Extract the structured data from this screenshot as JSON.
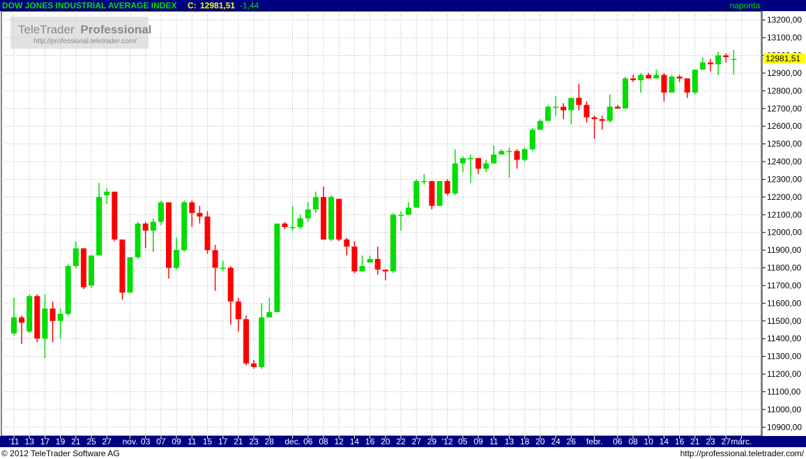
{
  "header": {
    "instrument": "DOW JONES INDUSTRIAL AVERAGE INDEX",
    "close_prefix": "C:",
    "close_value": "12981,51",
    "change": "-1,44",
    "period": "naponta"
  },
  "watermark": {
    "brand": "TeleTrader",
    "brand_bold": "Professional",
    "url": "http://professional.teletrader.com/"
  },
  "footer": {
    "copyright": "© 2012  TeleTrader Software AG",
    "url": "http://professional.teletrader.com/"
  },
  "colors": {
    "header_bg": "#000080",
    "header_text": "#00e000",
    "up": "#00dd00",
    "down": "#ff0000",
    "last_price_bg": "#ffff00",
    "grid": "#b0b0b0"
  },
  "chart_data": {
    "type": "candlestick",
    "y_axis": {
      "min": 10850,
      "max": 13250,
      "side": "right",
      "tick_values": [
        13200,
        13100,
        13000,
        12900,
        12800,
        12700,
        12600,
        12500,
        12400,
        12300,
        12200,
        12100,
        12000,
        11900,
        11800,
        11700,
        11600,
        11500,
        11400,
        11300,
        11200,
        11100,
        11000,
        10900
      ],
      "tick_labels": [
        "13200,00",
        "13100,00",
        "13000,00",
        "12900,00",
        "12800,00",
        "12700,00",
        "12600,00",
        "12500,00",
        "12400,00",
        "12300,00",
        "12200,00",
        "12100,00",
        "12000,00",
        "11900,00",
        "11800,00",
        "11700,00",
        "11600,00",
        "11500,00",
        "11400,00",
        "11300,00",
        "11200,00",
        "11100,00",
        "11000,00",
        "10900,00"
      ]
    },
    "x_labels": [
      {
        "i": 0,
        "t": "'11"
      },
      {
        "i": 2,
        "t": "13"
      },
      {
        "i": 4,
        "t": "17"
      },
      {
        "i": 6,
        "t": "19"
      },
      {
        "i": 8,
        "t": "21"
      },
      {
        "i": 10,
        "t": "25"
      },
      {
        "i": 12,
        "t": "27"
      },
      {
        "i": 15,
        "t": "nov."
      },
      {
        "i": 17,
        "t": "03"
      },
      {
        "i": 19,
        "t": "07"
      },
      {
        "i": 21,
        "t": "09"
      },
      {
        "i": 23,
        "t": "11"
      },
      {
        "i": 25,
        "t": "15"
      },
      {
        "i": 27,
        "t": "17"
      },
      {
        "i": 29,
        "t": "21"
      },
      {
        "i": 31,
        "t": "23"
      },
      {
        "i": 33,
        "t": "28"
      },
      {
        "i": 36,
        "t": "dec."
      },
      {
        "i": 38,
        "t": "06"
      },
      {
        "i": 40,
        "t": "08"
      },
      {
        "i": 42,
        "t": "12"
      },
      {
        "i": 44,
        "t": "14"
      },
      {
        "i": 46,
        "t": "16"
      },
      {
        "i": 48,
        "t": "20"
      },
      {
        "i": 50,
        "t": "22"
      },
      {
        "i": 52,
        "t": "27"
      },
      {
        "i": 54,
        "t": "29"
      },
      {
        "i": 56,
        "t": "'12"
      },
      {
        "i": 58,
        "t": "05"
      },
      {
        "i": 60,
        "t": "09"
      },
      {
        "i": 62,
        "t": "11"
      },
      {
        "i": 64,
        "t": "13"
      },
      {
        "i": 66,
        "t": "18"
      },
      {
        "i": 68,
        "t": "20"
      },
      {
        "i": 70,
        "t": "24"
      },
      {
        "i": 72,
        "t": "26"
      },
      {
        "i": 75,
        "t": "febr."
      },
      {
        "i": 78,
        "t": "06"
      },
      {
        "i": 80,
        "t": "08"
      },
      {
        "i": 82,
        "t": "10"
      },
      {
        "i": 84,
        "t": "14"
      },
      {
        "i": 86,
        "t": "16"
      },
      {
        "i": 88,
        "t": "21"
      },
      {
        "i": 90,
        "t": "23"
      },
      {
        "i": 92,
        "t": "27"
      },
      {
        "i": 94,
        "t": "márc."
      }
    ],
    "last_price": 12981.51,
    "last_price_label": "12981,51",
    "candles": [
      [
        11430,
        11520,
        11630,
        11420
      ],
      [
        11520,
        11490,
        11530,
        11370
      ],
      [
        11440,
        11640,
        11650,
        11430
      ],
      [
        11640,
        11400,
        11650,
        11380
      ],
      [
        11400,
        11570,
        11650,
        11290
      ],
      [
        11570,
        11500,
        11610,
        11380
      ],
      [
        11500,
        11540,
        11570,
        11400
      ],
      [
        11540,
        11810,
        11820,
        11530
      ],
      [
        11810,
        11910,
        11950,
        11800
      ],
      [
        11910,
        11690,
        11910,
        11680
      ],
      [
        11700,
        11870,
        11870,
        11690
      ],
      [
        11870,
        12200,
        12280,
        11870
      ],
      [
        12210,
        12230,
        12250,
        12160
      ],
      [
        12230,
        11960,
        12230,
        11950
      ],
      [
        11960,
        11660,
        11960,
        11620
      ],
      [
        11660,
        11860,
        11860,
        11660
      ],
      [
        11860,
        12050,
        12060,
        11850
      ],
      [
        12050,
        12010,
        12060,
        11910
      ],
      [
        12010,
        12060,
        12080,
        11890
      ],
      [
        12060,
        12170,
        12180,
        12040
      ],
      [
        12170,
        11800,
        12170,
        11740
      ],
      [
        11800,
        11900,
        11970,
        11790
      ],
      [
        11900,
        12170,
        12180,
        11890
      ],
      [
        12170,
        12110,
        12180,
        12030
      ],
      [
        12110,
        12090,
        12150,
        12050
      ],
      [
        12090,
        11900,
        12120,
        11880
      ],
      [
        11900,
        11800,
        11930,
        11670
      ],
      [
        11800,
        11800,
        11840,
        11780
      ],
      [
        11800,
        11610,
        11810,
        11480
      ],
      [
        11610,
        11510,
        11630,
        11440
      ],
      [
        11510,
        11260,
        11530,
        11250
      ],
      [
        11260,
        11240,
        11280,
        11230
      ],
      [
        11240,
        11520,
        11600,
        11230
      ],
      [
        11520,
        11550,
        11630,
        11520
      ],
      [
        11550,
        12050,
        12050,
        11550
      ],
      [
        12050,
        12030,
        12060,
        12020
      ],
      [
        12030,
        12030,
        12150,
        12010
      ],
      [
        12030,
        12080,
        12100,
        12020
      ],
      [
        12080,
        12130,
        12170,
        12060
      ],
      [
        12130,
        12200,
        12230,
        12110
      ],
      [
        12200,
        11960,
        12260,
        11960
      ],
      [
        11960,
        12200,
        12210,
        11950
      ],
      [
        12190,
        11960,
        12190,
        11950
      ],
      [
        11960,
        11920,
        11970,
        11870
      ],
      [
        11920,
        11780,
        11950,
        11770
      ],
      [
        11780,
        11810,
        11870,
        11780
      ],
      [
        11830,
        11850,
        11870,
        11830
      ],
      [
        11850,
        11790,
        11920,
        11760
      ],
      [
        11790,
        11780,
        11790,
        11730
      ],
      [
        11780,
        12100,
        12110,
        11770
      ],
      [
        12100,
        12100,
        12120,
        12010
      ],
      [
        12100,
        12140,
        12170,
        12100
      ],
      [
        12140,
        12290,
        12300,
        12140
      ],
      [
        12290,
        12290,
        12330,
        12270
      ],
      [
        12290,
        12150,
        12290,
        12130
      ],
      [
        12150,
        12290,
        12290,
        12150
      ],
      [
        12290,
        12220,
        12300,
        12210
      ],
      [
        12220,
        12390,
        12470,
        12210
      ],
      [
        12390,
        12420,
        12430,
        12340
      ],
      [
        12420,
        12420,
        12440,
        12280
      ],
      [
        12420,
        12360,
        12370,
        12330
      ],
      [
        12360,
        12390,
        12410,
        12340
      ],
      [
        12390,
        12440,
        12490,
        12390
      ],
      [
        12440,
        12460,
        12470,
        12440
      ],
      [
        12460,
        12460,
        12480,
        12310
      ],
      [
        12460,
        12410,
        12470,
        12360
      ],
      [
        12410,
        12470,
        12480,
        12400
      ],
      [
        12470,
        12580,
        12590,
        12460
      ],
      [
        12580,
        12630,
        12640,
        12580
      ],
      [
        12630,
        12710,
        12720,
        12630
      ],
      [
        12710,
        12710,
        12770,
        12660
      ],
      [
        12710,
        12690,
        12730,
        12640
      ],
      [
        12690,
        12760,
        12760,
        12610
      ],
      [
        12760,
        12720,
        12840,
        12690
      ],
      [
        12720,
        12650,
        12740,
        12620
      ],
      [
        12650,
        12640,
        12660,
        12530
      ],
      [
        12640,
        12630,
        12660,
        12580
      ],
      [
        12630,
        12710,
        12780,
        12620
      ],
      [
        12710,
        12700,
        12720,
        12700
      ],
      [
        12700,
        12870,
        12880,
        12700
      ],
      [
        12870,
        12860,
        12890,
        12850
      ],
      [
        12860,
        12890,
        12900,
        12790
      ],
      [
        12890,
        12870,
        12900,
        12870
      ],
      [
        12870,
        12890,
        12920,
        12870
      ],
      [
        12890,
        12790,
        12900,
        12740
      ],
      [
        12790,
        12880,
        12890,
        12820
      ],
      [
        12880,
        12870,
        12890,
        12850
      ],
      [
        12870,
        12790,
        12870,
        12760
      ],
      [
        12790,
        12920,
        12920,
        12780
      ],
      [
        12920,
        12960,
        12990,
        12920
      ],
      [
        12960,
        12950,
        12980,
        12910
      ],
      [
        12950,
        13000,
        13020,
        12890
      ],
      [
        13000,
        12990,
        13010,
        12960
      ],
      [
        12980,
        12980,
        13030,
        12890
      ]
    ]
  }
}
